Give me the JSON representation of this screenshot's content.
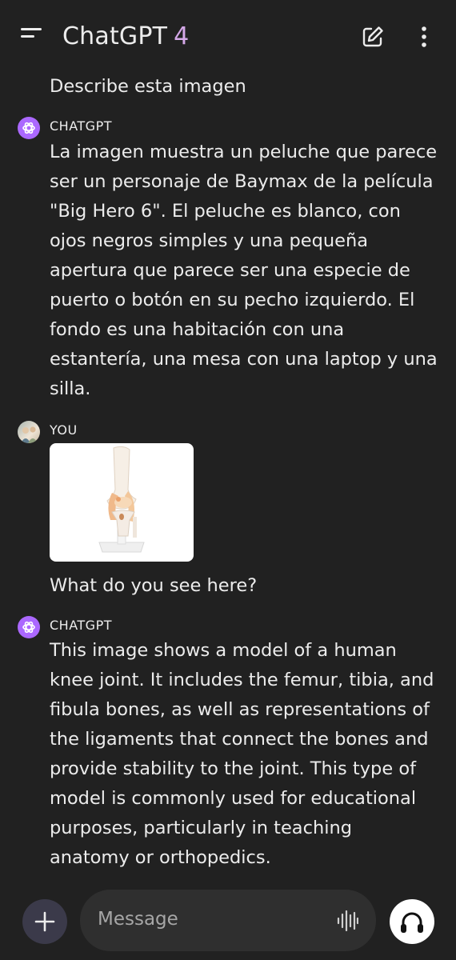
{
  "header": {
    "app_name": "ChatGPT",
    "version": "4"
  },
  "messages": [
    {
      "role": "user",
      "text": "Describe esta imagen"
    },
    {
      "role": "assistant",
      "sender": "CHATGPT",
      "lines": [
        "La imagen muestra un peluche que parece",
        "ser un personaje de Baymax de la película",
        "\"Big Hero 6\". El peluche es blanco, con",
        "ojos negros simples y una pequeña",
        "apertura que parece ser una especie de",
        "puerto o botón en su pecho izquierdo. El",
        "fondo es una habitación con una",
        "estantería, una mesa con una laptop y una",
        "silla."
      ]
    },
    {
      "role": "user",
      "sender": "YOU",
      "attachment": "knee-joint-model-image",
      "text": "What do you see here?"
    },
    {
      "role": "assistant",
      "sender": "CHATGPT",
      "lines": [
        "This image shows a model of a human",
        "knee joint. It includes the femur, tibia, and",
        "fibula bones, as well as representations of",
        "the ligaments that connect the bones and",
        "provide stability to the joint. This type of",
        "model is commonly used for educational",
        "purposes, particularly in teaching",
        "anatomy or orthopedics."
      ]
    }
  ],
  "composer": {
    "placeholder": "Message"
  },
  "icons": {
    "menu": "menu-icon",
    "new_chat": "edit-icon",
    "more": "more-vertical-icon",
    "attach": "plus-icon",
    "voice": "waveform-icon",
    "voice_mode": "headphones-icon",
    "assistant_avatar": "openai-logo-icon"
  },
  "colors": {
    "background": "#212121",
    "version_accent": "#d4a8e8",
    "assistant_avatar": "#ab68ff",
    "composer_field": "#2f2f2f"
  }
}
